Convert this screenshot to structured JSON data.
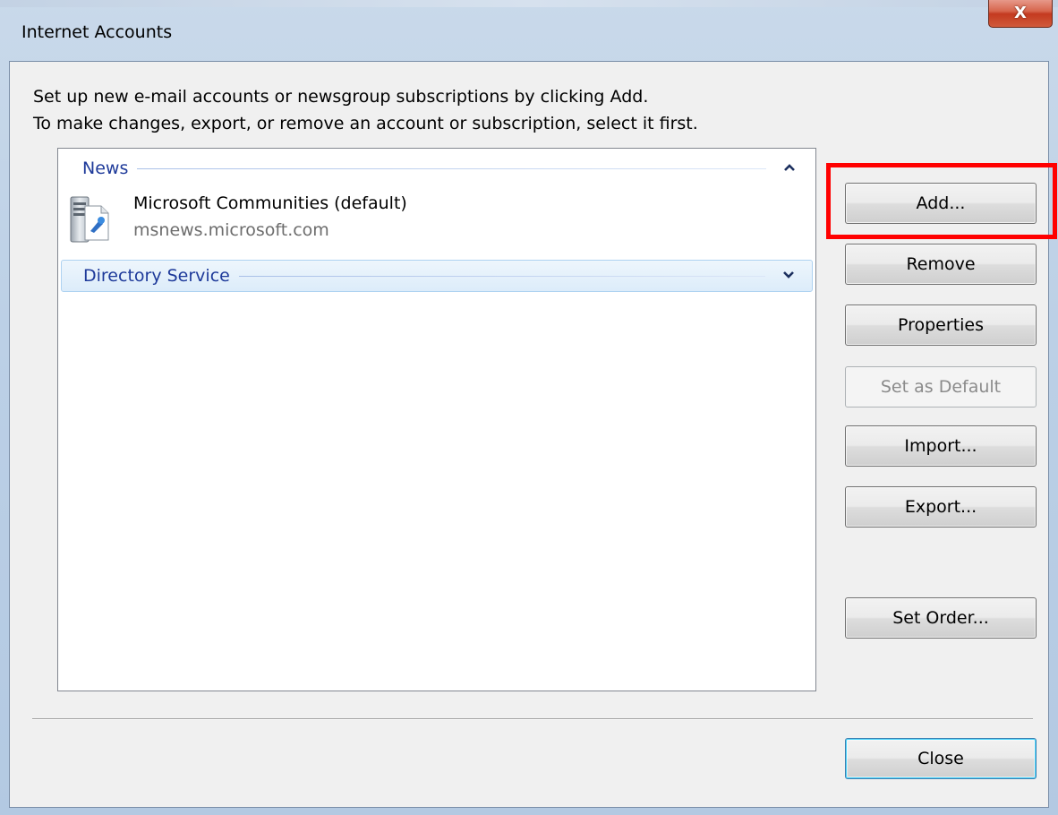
{
  "window": {
    "title": "Internet Accounts",
    "close_glyph": "X"
  },
  "instructions": {
    "line1": "Set up new e-mail accounts or newsgroup subscriptions by clicking Add.",
    "line2": "To make changes, export, or remove an account or subscription, select it first."
  },
  "list": {
    "groups": [
      {
        "label": "News",
        "state": "expanded",
        "chevron": "up-chevron-icon",
        "items": [
          {
            "name": "Microsoft Communities (default)",
            "server": "msnews.microsoft.com",
            "icon": "news-server-icon"
          }
        ]
      },
      {
        "label": "Directory Service",
        "state": "collapsed",
        "chevron": "down-chevron-icon",
        "items": []
      }
    ]
  },
  "buttons": {
    "add": "Add...",
    "remove": "Remove",
    "properties": "Properties",
    "set_default": "Set as Default",
    "import": "Import...",
    "export": "Export...",
    "set_order": "Set Order...",
    "close": "Close"
  },
  "colors": {
    "highlight": "#ff0000",
    "group_text": "#1e3a9a"
  }
}
